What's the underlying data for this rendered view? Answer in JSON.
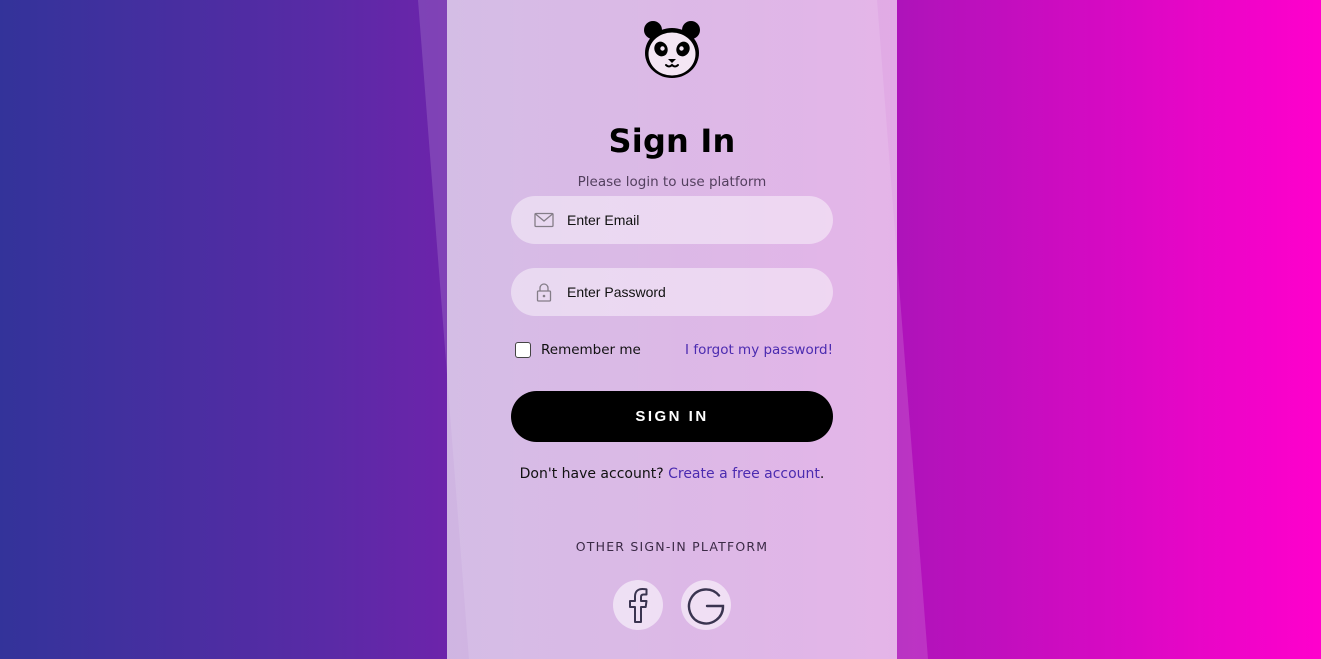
{
  "header": {
    "logo_icon": "panda-icon",
    "title": "Sign In",
    "subtitle": "Please login to use platform"
  },
  "form": {
    "email": {
      "icon": "envelope-icon",
      "placeholder": "Enter Email",
      "value": ""
    },
    "password": {
      "icon": "lock-icon",
      "placeholder": "Enter Password",
      "value": ""
    },
    "remember_label": "Remember me",
    "remember_checked": false,
    "forgot_label": "I forgot my password!",
    "submit_label": "SIGN IN"
  },
  "signup": {
    "prompt": "Don't have account?",
    "link_label": "Create a free account",
    "suffix": "."
  },
  "social": {
    "heading": "OTHER SIGN-IN PLATFORM",
    "providers": [
      {
        "icon": "facebook-icon"
      },
      {
        "icon": "google-icon"
      }
    ]
  },
  "colors": {
    "background_left": "#33339a",
    "background_right": "#ff00cc",
    "button": "#000000",
    "link": "#4b2bb0"
  }
}
